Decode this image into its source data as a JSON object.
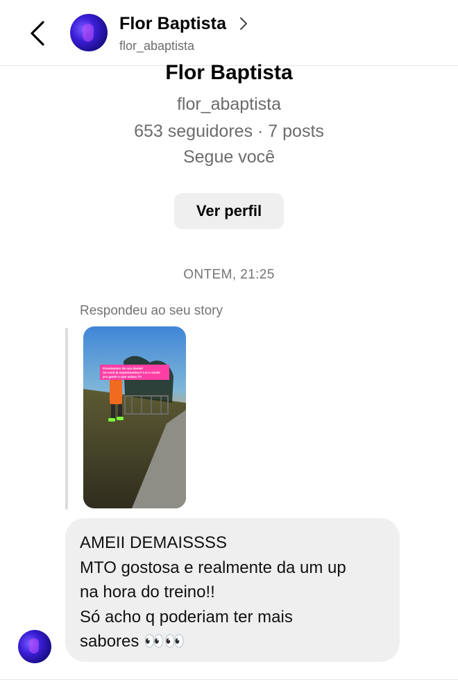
{
  "header": {
    "name": "Flor Baptista",
    "username": "flor_abaptista",
    "chevron_icon": "chevron-right-icon",
    "back_icon": "chevron-left-icon"
  },
  "profile": {
    "name": "Flor Baptista",
    "username": "flor_abaptista",
    "stats": "653 seguidores · 7 posts",
    "follow_status": "Segue você",
    "view_profile_label": "Ver perfil"
  },
  "conversation": {
    "timestamp": "ONTEM, 21:25",
    "reply_label": "Respondeu ao seu story",
    "story": {
      "sticker_text_1": "Provinamos da sua deslei!",
      "sticker_text_2": "Se você já experimentou? Lei o vocês",
      "sticker_text_3": "pra gente o que achou ?!!"
    },
    "message_lines": [
      "AMEII DEMAISSSS",
      "MTO gostosa e realmente da um up",
      "na hora do treino!!",
      "Só acho q poderiam ter mais",
      "sabores 👀👀"
    ]
  },
  "colors": {
    "secondary_text": "#6b6b6b",
    "bubble_bg": "#efefef",
    "button_bg": "#efefef",
    "sticker_pink": "#ff3ea5"
  }
}
